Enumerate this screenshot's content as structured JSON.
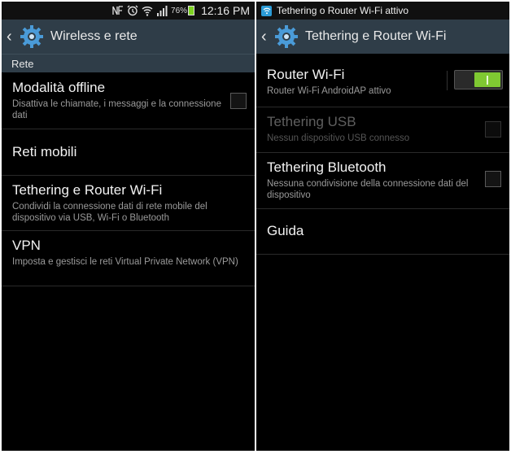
{
  "left": {
    "status": {
      "battery": "76%",
      "time": "12:16 PM"
    },
    "header": {
      "title": "Wireless e rete"
    },
    "section": "Rete",
    "items": [
      {
        "title": "Modalità offline",
        "summary": "Disattiva le chiamate, i messaggi e la connessione dati",
        "checked": false
      },
      {
        "title": "Reti mobili",
        "summary": ""
      },
      {
        "title": "Tethering e Router Wi-Fi",
        "summary": "Condividi la connessione dati di rete mobile del dispositivo via USB, Wi-Fi o Bluetooth"
      },
      {
        "title": "VPN",
        "summary": "Imposta e gestisci le reti Virtual Private Network (VPN)"
      }
    ]
  },
  "right": {
    "status": {
      "notification": "Tethering o Router Wi-Fi attivo"
    },
    "header": {
      "title": "Tethering e Router Wi-Fi"
    },
    "items": [
      {
        "title": "Router Wi-Fi",
        "summary": "Router Wi-Fi AndroidAP attivo",
        "toggle_on": true
      },
      {
        "title": "Tethering USB",
        "summary": "Nessun dispositivo USB connesso",
        "enabled": false,
        "checked": false
      },
      {
        "title": "Tethering Bluetooth",
        "summary": "Nessuna condivisione della connessione dati del dispositivo",
        "checked": false
      },
      {
        "title": "Guida",
        "summary": ""
      }
    ]
  },
  "colors": {
    "actionbar": "#2f3d48",
    "toggle_on": "#7fc832",
    "background": "#000000"
  }
}
